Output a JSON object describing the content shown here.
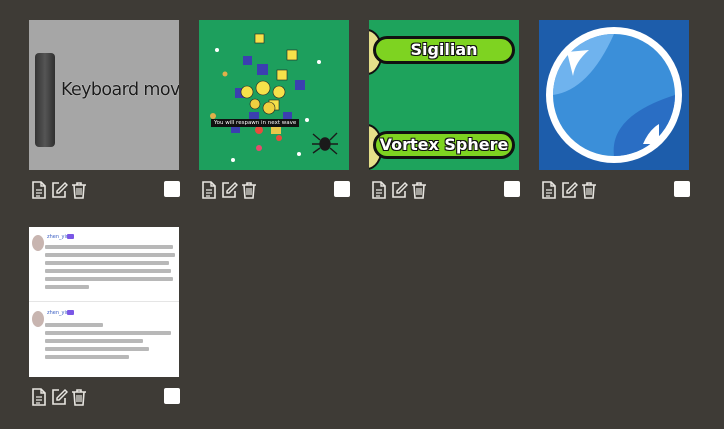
{
  "colors": {
    "background": "#3e3b36",
    "icon": "#e8e6e1",
    "checkbox": "#ffffff"
  },
  "tiles": [
    {
      "title_text": "Keyboard movement",
      "actions": [
        "document-icon",
        "edit-icon",
        "trash-icon"
      ],
      "checked": false
    },
    {
      "toast_text": "You will respawn in next wave",
      "actions": [
        "document-icon",
        "edit-icon",
        "trash-icon"
      ],
      "checked": false
    },
    {
      "pill_top": "Sigilian",
      "pill_bottom": "Vortex Sphere",
      "actions": [
        "document-icon",
        "edit-icon",
        "trash-icon"
      ],
      "checked": false
    },
    {
      "image": "blue-orb-with-white-ring",
      "actions": [
        "document-icon",
        "edit-icon",
        "trash-icon"
      ],
      "checked": false
    },
    {
      "image": "chat-posts-screenshot",
      "user_name": "zhen_yin",
      "actions": [
        "document-icon",
        "edit-icon",
        "trash-icon"
      ],
      "checked": false
    }
  ]
}
